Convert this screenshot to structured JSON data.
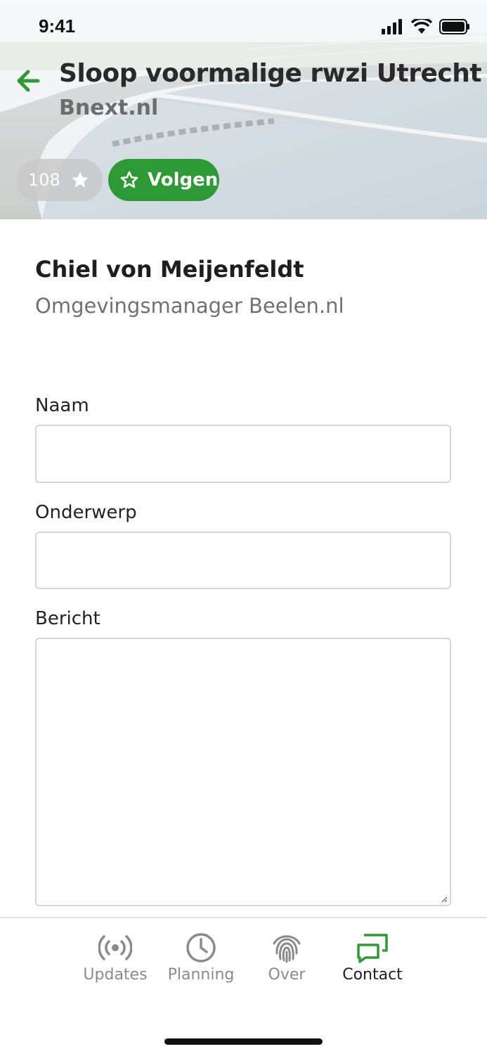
{
  "status_bar": {
    "time": "9:41"
  },
  "header": {
    "title": "Sloop voormalige rwzi Utrecht",
    "subtitle": "Bnext.nl",
    "followers_count": "108",
    "follow_label": "Volgen",
    "accent_color": "#2e9a36"
  },
  "contact": {
    "name": "Chiel von Meijenfeldt",
    "role": "Omgevingsmanager Beelen.nl"
  },
  "form": {
    "name_label": "Naam",
    "name_value": "",
    "subject_label": "Onderwerp",
    "subject_value": "",
    "message_label": "Bericht",
    "message_value": ""
  },
  "tabbar": {
    "tabs": [
      {
        "label": "Updates",
        "icon": "broadcast-icon"
      },
      {
        "label": "Planning",
        "icon": "clock-icon"
      },
      {
        "label": "Over",
        "icon": "fingerprint-icon"
      },
      {
        "label": "Contact",
        "icon": "chat-icon",
        "active": true
      }
    ]
  }
}
